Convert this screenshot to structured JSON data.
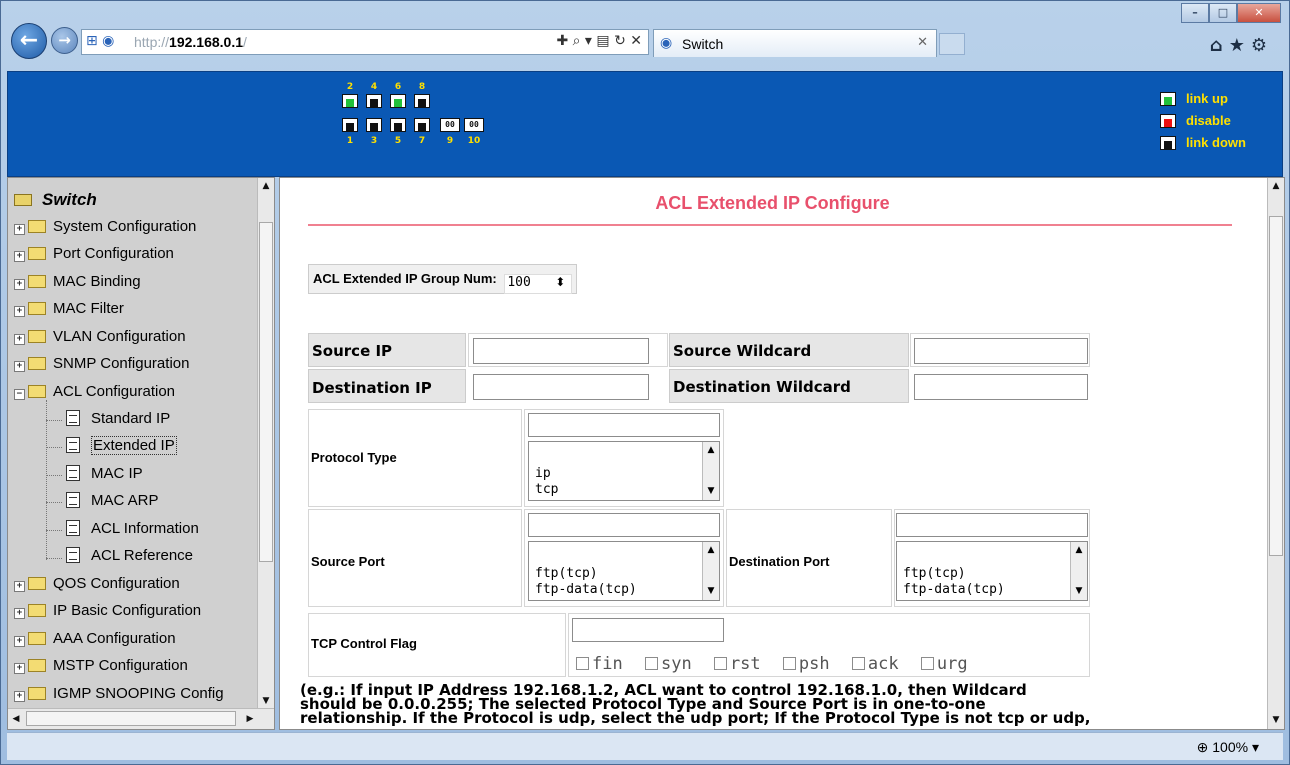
{
  "browser": {
    "url_prefix": "http://",
    "url_host": "192.168.0.1",
    "url_suffix": "/",
    "tab_title": "Switch",
    "zoom": "100%"
  },
  "banner": {
    "top_port_numbers": [
      "2",
      "4",
      "6",
      "8"
    ],
    "bottom_port_numbers": [
      "1",
      "3",
      "5",
      "7",
      "9",
      "10"
    ],
    "legend": {
      "link_up": "link up",
      "disable": "disable",
      "link_down": "link down"
    },
    "port_states": {
      "port2": "up",
      "port4": "down",
      "port6": "up",
      "port8": "down",
      "port1": "down",
      "port3": "down",
      "port5": "down",
      "port7": "down"
    },
    "colors": {
      "background": "#0a58b4",
      "up": "#22c13a",
      "disable": "#e11111",
      "text": "#ffe000"
    }
  },
  "sidebar": {
    "root": "Switch",
    "items": [
      {
        "label": "System Configuration"
      },
      {
        "label": "Port Configuration"
      },
      {
        "label": "MAC Binding"
      },
      {
        "label": "MAC Filter"
      },
      {
        "label": "VLAN Configuration"
      },
      {
        "label": "SNMP Configuration"
      },
      {
        "label": "ACL Configuration",
        "expanded": true
      },
      {
        "label": "QOS Configuration"
      },
      {
        "label": "IP Basic Configuration"
      },
      {
        "label": "AAA Configuration"
      },
      {
        "label": "MSTP Configuration"
      },
      {
        "label": "IGMP SNOOPING Config"
      }
    ],
    "acl_children": [
      {
        "label": "Standard IP"
      },
      {
        "label": "Extended IP",
        "selected": true
      },
      {
        "label": "MAC IP"
      },
      {
        "label": "MAC ARP"
      },
      {
        "label": "ACL Information"
      },
      {
        "label": "ACL Reference"
      }
    ]
  },
  "page": {
    "title": "ACL Extended IP Configure",
    "title_color": "#e8506c",
    "group_num_label": "ACL Extended IP Group Num:",
    "group_num_value": "100",
    "source_ip_label": "Source IP",
    "source_wildcard_label": "Source Wildcard",
    "destination_ip_label": "Destination IP",
    "destination_wildcard_label": "Destination Wildcard",
    "protocol_type_label": "Protocol Type",
    "protocol_options": [
      "ip",
      "tcp"
    ],
    "source_port_label": "Source Port",
    "destination_port_label": "Destination Port",
    "port_options": [
      "ftp(tcp)",
      "ftp-data(tcp)"
    ],
    "tcp_flag_label": "TCP Control Flag",
    "tcp_flags": [
      "fin",
      "syn",
      "rst",
      "psh",
      "ack",
      "urg"
    ],
    "note_lines": [
      "(e.g.: If input IP Address 192.168.1.2, ACL want to control 192.168.1.0, then Wildcard",
      "should be 0.0.0.255; The selected Protocol Type and Source Port is in one-to-one",
      "relationship. If the Protocol is udp, select the udp port; If the Protocol Type is not tcp or udp,"
    ]
  }
}
